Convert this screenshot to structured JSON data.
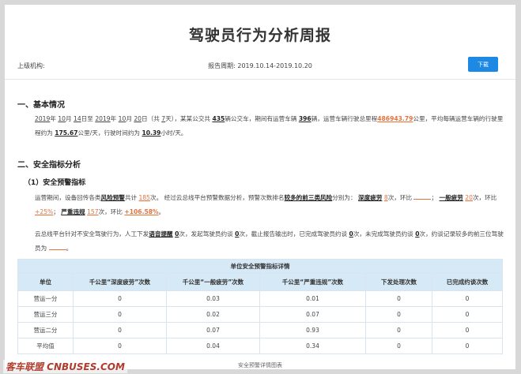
{
  "header": {
    "title": "驾驶员行为分析周报",
    "org_label": "上级机构:",
    "period_label": "报告周期:",
    "period_value": "2019.10.14-2019.10.20",
    "download_label": "下载"
  },
  "section1": {
    "heading": "一、基本情况",
    "t1": "2019",
    "t2": "年",
    "t3": "10",
    "t4": "月",
    "t5": "14",
    "t6": "日至",
    "t7": "2019",
    "t8": "年",
    "t9": "10",
    "t10": "月",
    "t11": "20",
    "t12": "日（共",
    "t13": "7",
    "t14": "天），某某公交共",
    "t15": "435",
    "t16": "辆公交车，期间有运营车辆",
    "t17": "396",
    "t18": "辆，运营车辆行驶总里程",
    "t19": "486943.79",
    "t20": "公里，平均每辆运营车辆的行驶里程约为",
    "t21": "175.67",
    "t22": "公里/天，行驶时间约为",
    "t23": "10.39",
    "t24": "小时/天。"
  },
  "section2": {
    "heading": "二、安全指标分析",
    "sub1": "（1）安全预警指标",
    "p1": {
      "a": "运营期间，设备回传各类",
      "b": "风险预警",
      "c": "共计",
      "d": "185",
      "e": "次。 经过云总线平台预警数据分析，预警次数排名",
      "f": "较多的前三类风险",
      "g": "分别为：",
      "h": "深度疲劳",
      "i": "8",
      "j": "次，环比",
      "k": "；",
      "l": "一般疲劳",
      "m": "20",
      "n": "次，环比",
      "o": "+25%",
      "p": "；",
      "q": "严重违规",
      "r": "157",
      "s": "次，环比",
      "t": "+106.58%",
      "u": "。"
    },
    "p2": {
      "a": "云总线平台针对不安全驾驶行为，人工下发",
      "b": "语音提醒",
      "c": "0",
      "d": "次，发起驾驶员约谈",
      "e": "0",
      "f": "次，截止报告输出时，已完成驾驶员约谈",
      "g": "0",
      "h": "次，未完成驾驶员约谈",
      "i": "0",
      "j": "次，约谈记录较多的前三位驾驶员为",
      "k": "。"
    }
  },
  "table": {
    "caption": "单位安全预警指标详情",
    "columns": [
      "单位",
      "千公里“深度疲劳”次数",
      "千公里“一般疲劳”次数",
      "千公里“严重违规”次数",
      "下发处理次数",
      "已完成约谈次数"
    ],
    "rows": [
      [
        "营运一分",
        "0",
        "0.03",
        "0.01",
        "0",
        "0"
      ],
      [
        "营运三分",
        "0",
        "0.02",
        "0.07",
        "0",
        "0"
      ],
      [
        "营运二分",
        "0",
        "0.07",
        "0.93",
        "0",
        "0"
      ],
      [
        "平均值",
        "0",
        "0.04",
        "0.34",
        "0",
        "0"
      ]
    ],
    "footer": "安全预警详情图表"
  },
  "watermark": "客车联盟 CNBUSES.COM"
}
